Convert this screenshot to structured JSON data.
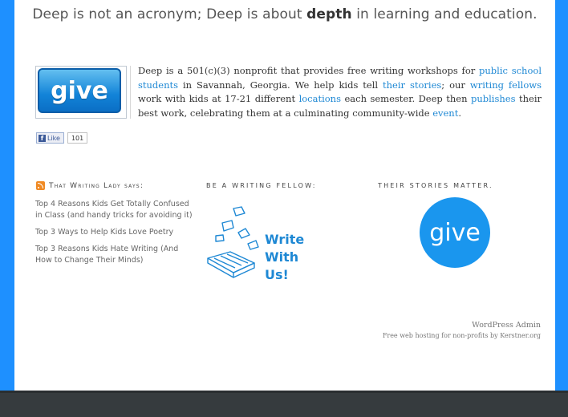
{
  "tagline": {
    "pre": "Deep is not an acronym; Deep is about ",
    "bold": "depth",
    "post": " in learning and education."
  },
  "give_button": {
    "label": "give"
  },
  "intro": {
    "t1": "Deep is a 501(c)(3) nonprofit that provides free writing workshops for ",
    "l1": "public school students",
    "t2": " in Savannah, Georgia. We help kids tell ",
    "l2": "their stories",
    "t3": "; our ",
    "l3": "writing fellows",
    "t4": " work with kids at 17-21 different ",
    "l4": "locations",
    "t5": " each semester. Deep then ",
    "l5": "publishes",
    "t6": " their best work, celebrating them at a culminating community-wide ",
    "l6": "event",
    "t7": "."
  },
  "facebook": {
    "like_label": "Like",
    "count": "101"
  },
  "column1": {
    "heading": "That Writing Lady says:",
    "posts": [
      "Top 4 Reasons Kids Get Totally Confused in Class (and handy tricks for avoiding it)",
      "Top 3 Ways to Help Kids Love Poetry",
      "Top 3 Reasons Kids Hate Writing (And How to Change Their Minds)"
    ]
  },
  "column2": {
    "heading": "Be a writing fellow:",
    "line1": "Write",
    "line2": "With",
    "line3": "Us!"
  },
  "column3": {
    "heading": "Their stories matter.",
    "give_label": "give"
  },
  "footer": {
    "admin": "WordPress Admin",
    "hosting": "Free web hosting for non-profits by Kerstner.org"
  },
  "colors": {
    "accent": "#1e90ff",
    "link": "#1e88d4",
    "footer_bar": "#363b3e"
  }
}
